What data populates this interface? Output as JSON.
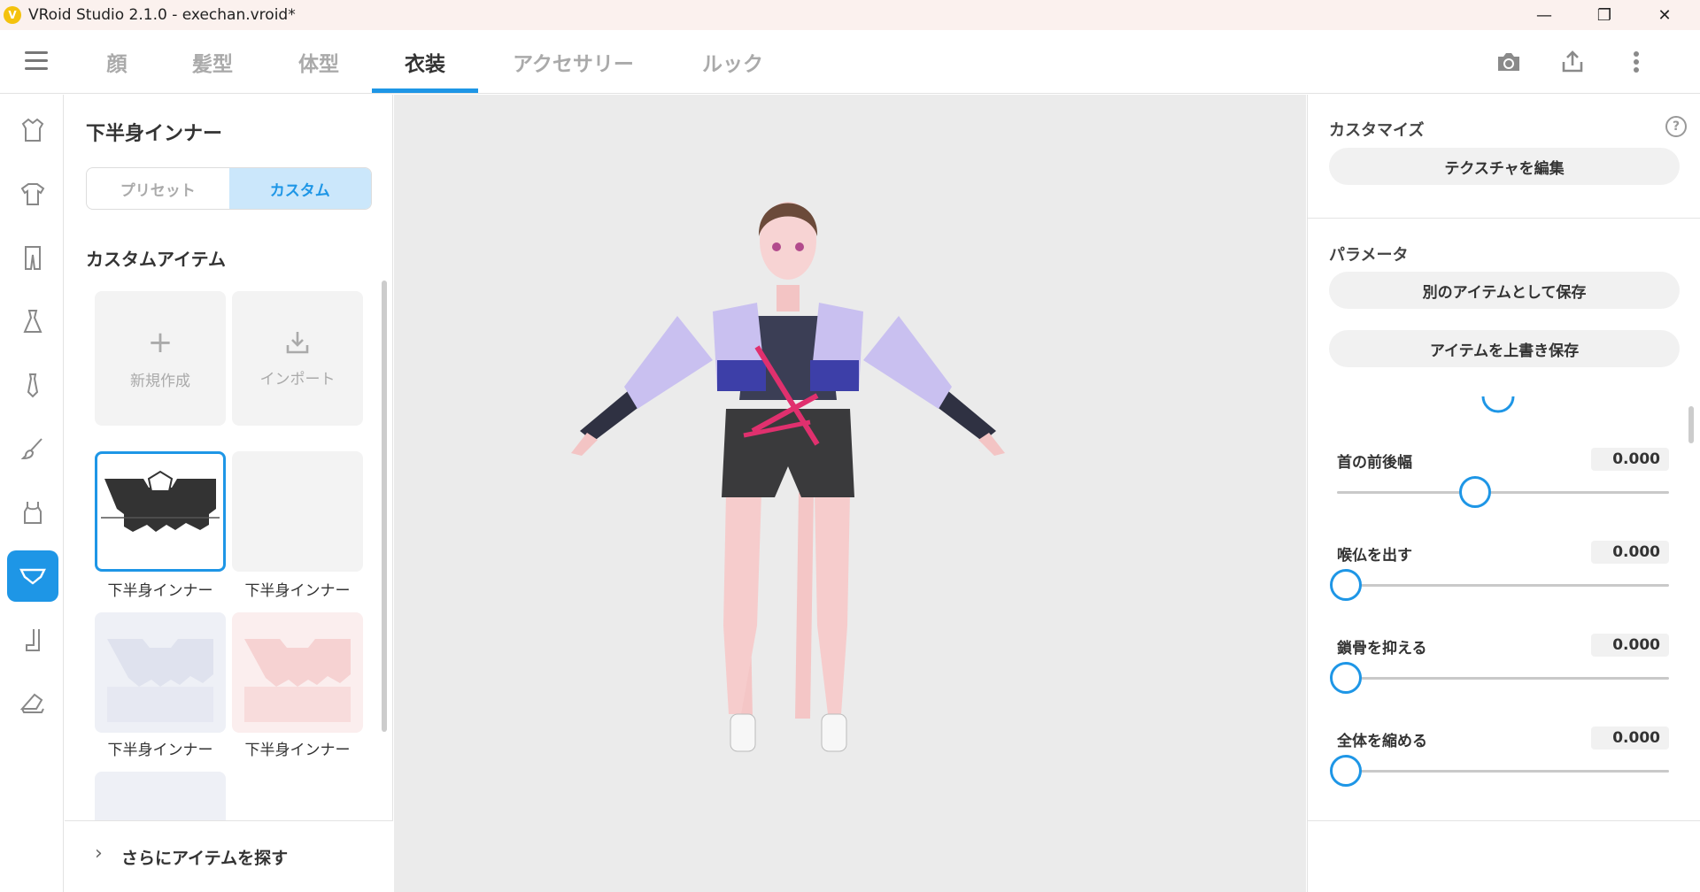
{
  "window": {
    "title": "VRoid Studio 2.1.0 - exechan.vroid*",
    "logo_glyph": "V",
    "controls": {
      "minimize": "—",
      "maximize": "❐",
      "close": "✕"
    }
  },
  "topnav": {
    "tabs": [
      {
        "label": "顔"
      },
      {
        "label": "髪型"
      },
      {
        "label": "体型"
      },
      {
        "label": "衣装",
        "active": true
      },
      {
        "label": "アクセサリー"
      },
      {
        "label": "ルック"
      }
    ],
    "icons": [
      "camera-icon",
      "share-export-icon",
      "more-vert-icon"
    ]
  },
  "sidebar": {
    "icons": [
      "coat-icon",
      "tshirt-icon",
      "pants-icon",
      "dress-icon",
      "necktie-icon",
      "brush-icon",
      "tanktop-icon",
      "underwear-icon",
      "sock-icon",
      "shoe-icon"
    ],
    "active_index": 7
  },
  "item_panel": {
    "title": "下半身インナー",
    "segment": {
      "preset": "プリセット",
      "custom": "カスタム"
    },
    "section_title": "カスタムアイテム",
    "new_label": "新規作成",
    "new_glyph": "+",
    "import_label": "インポート",
    "items": [
      {
        "label": "下半身インナー"
      },
      {
        "label": "下半身インナー"
      },
      {
        "label": "下半身インナー"
      },
      {
        "label": "下半身インナー"
      }
    ],
    "more_chevron": "›",
    "more_label": "さらにアイテムを探す"
  },
  "right_panel": {
    "customize_heading": "カスタマイズ",
    "help_glyph": "?",
    "edit_texture": "テクスチャを編集",
    "params_heading": "パラメータ",
    "save_as_new": "別のアイテムとして保存",
    "overwrite_save": "アイテムを上書き保存",
    "params": [
      {
        "label": "首の前後幅",
        "value": "0.000",
        "level": 0.41
      },
      {
        "label": "喉仏を出す",
        "value": "0.000",
        "level": 0.0
      },
      {
        "label": "鎖骨を抑える",
        "value": "0.000",
        "level": 0.0
      },
      {
        "label": "全体を縮める",
        "value": "0.000",
        "level": 0.0
      }
    ]
  },
  "colors": {
    "accent": "#1e96e6",
    "titlebar": "#fbf1ee",
    "viewport_bg": "#ebebeb"
  }
}
